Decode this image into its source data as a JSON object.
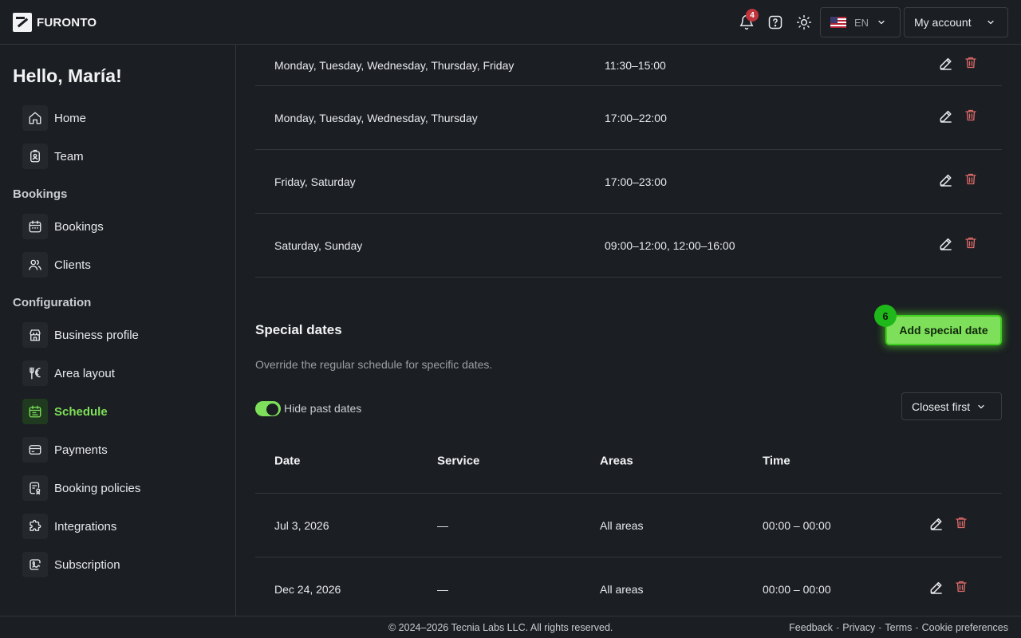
{
  "brand": {
    "name": "FURONTO"
  },
  "header": {
    "notifications_count": "4",
    "language": "EN",
    "account_label": "My account"
  },
  "sidebar": {
    "greeting": "Hello, María!",
    "items_top": [
      {
        "label": "Home",
        "icon": "home-icon"
      },
      {
        "label": "Team",
        "icon": "badge-icon"
      }
    ],
    "bookings_section": "Bookings",
    "items_bookings": [
      {
        "label": "Bookings",
        "icon": "calendar-icon"
      },
      {
        "label": "Clients",
        "icon": "users-icon"
      }
    ],
    "config_section": "Configuration",
    "items_config": [
      {
        "label": "Business profile",
        "icon": "store-icon"
      },
      {
        "label": "Area layout",
        "icon": "utensils-icon"
      },
      {
        "label": "Schedule",
        "icon": "calendar-icon",
        "active": true
      },
      {
        "label": "Payments",
        "icon": "credit-card-icon"
      },
      {
        "label": "Booking policies",
        "icon": "policy-icon"
      },
      {
        "label": "Integrations",
        "icon": "puzzle-icon"
      },
      {
        "label": "Subscription",
        "icon": "subscription-icon"
      }
    ]
  },
  "schedule": {
    "rows": [
      {
        "days": "Monday, Tuesday, Wednesday, Thursday, Friday",
        "time": "11:30–15:00"
      },
      {
        "days": "Monday, Tuesday, Wednesday, Thursday",
        "time": "17:00–22:00"
      },
      {
        "days": "Friday, Saturday",
        "time": "17:00–23:00"
      },
      {
        "days": "Saturday, Sunday",
        "time": "09:00–12:00, 12:00–16:00"
      }
    ]
  },
  "special": {
    "title": "Special dates",
    "description": "Override the regular schedule for specific dates.",
    "add_button": "Add special date",
    "step_badge": "6",
    "toggle_label": "Hide past dates",
    "toggle_on": true,
    "sort_label": "Closest first",
    "columns": [
      "Date",
      "Service",
      "Areas",
      "Time"
    ],
    "rows": [
      {
        "date": "Jul 3, 2026",
        "service": "—",
        "areas": "All areas",
        "time": "00:00 – 00:00"
      },
      {
        "date": "Dec 24, 2026",
        "service": "—",
        "areas": "All areas",
        "time": "00:00 – 00:00"
      }
    ]
  },
  "footer": {
    "copyright": "© 2024–2026 Tecnia Labs LLC. All rights reserved.",
    "links": [
      "Feedback",
      "Privacy",
      "Terms",
      "Cookie preferences"
    ],
    "separator": "-"
  },
  "colors": {
    "background": "#1b1e22",
    "accent": "#7ee05a",
    "danger": "#e06a6a",
    "badge": "#c0343b"
  }
}
